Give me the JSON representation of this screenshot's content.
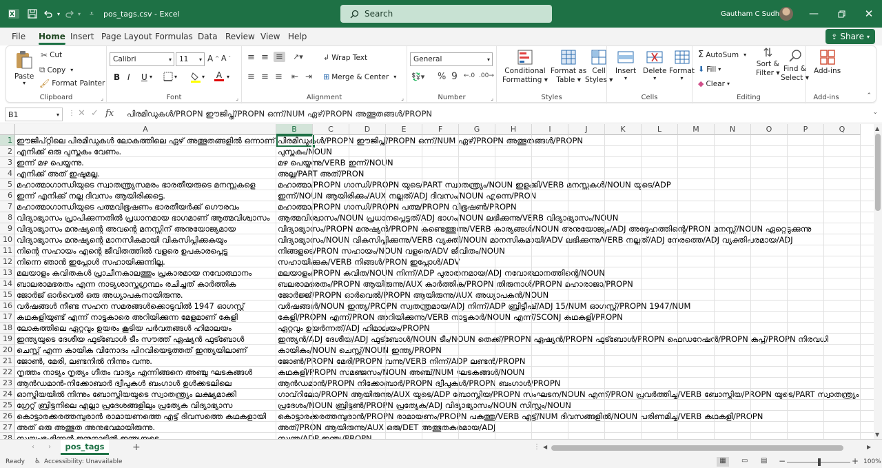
{
  "titlebar": {
    "filename": "pos_tags.csv",
    "app": "Excel",
    "search_placeholder": "Search",
    "user": "Gautham C Sudheer"
  },
  "menu": {
    "tabs": [
      "File",
      "Home",
      "Insert",
      "Page Layout",
      "Formulas",
      "Data",
      "Review",
      "View",
      "Help"
    ],
    "active": "Home",
    "share": "Share"
  },
  "ribbon": {
    "clipboard": {
      "paste": "Paste",
      "cut": "Cut",
      "copy": "Copy",
      "format_painter": "Format Painter",
      "label": "Clipboard"
    },
    "font": {
      "name": "Calibri",
      "size": "11",
      "bold": "B",
      "italic": "I",
      "underline": "U",
      "label": "Font"
    },
    "alignment": {
      "wrap": "Wrap Text",
      "merge": "Merge & Center",
      "label": "Alignment"
    },
    "number": {
      "format": "General",
      "label": "Number"
    },
    "styles": {
      "conditional": "Conditional",
      "conditional2": "Formatting",
      "format_table": "Format as",
      "format_table2": "Table",
      "cell_styles": "Cell",
      "cell_styles2": "Styles",
      "label": "Styles"
    },
    "cells": {
      "insert": "Insert",
      "delete": "Delete",
      "format": "Format",
      "label": "Cells"
    },
    "editing": {
      "autosum": "AutoSum",
      "fill": "Fill",
      "clear": "Clear",
      "sort": "Sort &",
      "sort2": "Filter",
      "find": "Find &",
      "find2": "Select",
      "label": "Editing"
    },
    "addins": {
      "addins": "Add-ins",
      "label": "Add-ins"
    }
  },
  "formula_bar": {
    "name_box": "B1",
    "fx": "fx",
    "content": "പിരമിഡുകൾ/PROPN ഈജിപ്ത്/PROPN ഒന്ന്/NUM ഏഴ്/PROPN അത്ഭുതങ്ങൾ/PROPN"
  },
  "grid": {
    "columns": [
      "A",
      "B",
      "C",
      "D",
      "E",
      "F",
      "G",
      "H",
      "I",
      "J",
      "K",
      "L",
      "M",
      "N",
      "O",
      "P",
      "Q"
    ],
    "selected_cell": "B1",
    "rows": [
      {
        "n": "1",
        "a": "ഈജിപ്റ്റിലെ പിരമിഡുകൾ ലോകത്തിലെ ഏഴ് അത്ഭുതങ്ങളിൽ ഒന്നാണ്",
        "b": "പിരമിഡുകൾ/PROPN ഈജിപ്ത്/PROPN ഒന്ന്/NUM ഏഴ്/PROPN അത്ഭുതങ്ങൾ/PROPN"
      },
      {
        "n": "2",
        "a": "എനിക്ക് ഒരു പുസ്തകം വേണം.",
        "b": "പുസ്തകം/NOUN"
      },
      {
        "n": "3",
        "a": "ഇന്ന് മഴ പെയ്യുന്നു.",
        "b": "മഴ പെയ്യുന്നു/VERB ഇന്ന്/NOUN"
      },
      {
        "n": "4",
        "a": "എനിക്ക് അത് ഇഷ്ടമല്ല.",
        "b": "അല്ല/PART അത്/PRON"
      },
      {
        "n": "5",
        "a": "മഹാത്മാഗാന്ധിയുടെ സ്വാതന്ത്ര്യസമരം ഭാരതീയരുടെ മനസ്സുകളെ",
        "b": "മഹാത്മാ/PROPN ഗാന്ധി/PROPN യുടെ/PART സ്വാതന്ത്ര്യം/NOUN ഇളക്കി/VERB മനസ്സുകൾ/NOUN യുടെ/ADP"
      },
      {
        "n": "6",
        "a": "ഇന്ന് എനിക്ക് നല്ല ദിവസം ആയിരിക്കട്ടെ.",
        "b": "ഇന്ന്/NOUN ആയിരിക്കും/AUX നല്ലത്/ADJ ദിവസം/NOUN എന്നെ/PRON"
      },
      {
        "n": "7",
        "a": "മഹാത്മാഗാന്ധിയുടെ പത്മവിഭൂഷണം ഭാരതീയർക്ക് ഗൌരവം",
        "b": "മഹാത്മാ/PROPN ഗാന്ധി/PROPN പത്മ/PROPN വിഭൂഷൺ/PROPN"
      },
      {
        "n": "8",
        "a": "വിദ്യാഭ്യാസം പ്രാപിക്കുന്നതിൽ പ്രധാനമായ ഭാഗമാണ് ആത്മവിശ്വാസം",
        "b": "ആത്മവിശ്വാസം/NOUN പ്രധാനപ്പെട്ടത്/ADJ ഭാഗം/NOUN ലഭിക്കുന്നു/VERB വിദ്യാഭ്യാസം/NOUN"
      },
      {
        "n": "9",
        "a": "വിദ്യാഭ്യാസം മനുഷ്യന്റെ അവന്റെ മനസ്സിന് അനുയോജ്യമായ",
        "b": "വിദ്യാഭ്യാസം/PROPN മനുഷ്യൻ/PROPN കണ്ടെത്തുന്നു/VERB കാര്യങ്ങൾ/NOUN അനുയോജ്യം/ADJ അദ്ദേഹത്തിന്റെ/PRON മനസ്സ്/NOUN ഏറ്റെടുക്കുന്നു"
      },
      {
        "n": "10",
        "a": "വിദ്യാഭ്യാസം മനുഷ്യന്റെ മാനസികമായി വികസിപ്പിക്കുകയും",
        "b": "വിദ്യാഭ്യാസം/NOUN വികസിപ്പിക്കുന്നു/VERB വ്യക്തി/NOUN മാനസികമായി/ADV ലഭിക്കുന്നു/VERB നല്ലത്/ADJ നേരത്തെ/ADJ വ്യക്തിപരമായ/ADJ"
      },
      {
        "n": "11",
        "a": "നിന്റെ സഹായം എന്റെ ജീവിതത്തിൽ വളരെ ഉപകാരപ്പെട്ടു",
        "b": "നിങ്ങളുടെ/PRON സഹായം/NOUN വളരെ/ADV ജീവിതം/NOUN"
      },
      {
        "n": "12",
        "a": "നിന്നെ ഞാൻ ഇപ്പോൾ സഹായിക്കുന്നില്ല.",
        "b": "സഹായിക്കുക/VERB നിങ്ങൾ/PRON ഇപ്പോൾ/ADV"
      },
      {
        "n": "13",
        "a": "മലയാളം കവിതകൾ പ്രാചീനകാലത്തും പ്രകാരമായ നവോത്ഥാനം",
        "b": "മലയാളം/PROPN കവിത/NOUN നിന്ന്/ADP പുരാതനമായ/ADJ നവോത്ഥാനത്തിന്റെ/NOUN"
      },
      {
        "n": "14",
        "a": "ബാലരാമഭരതം എന്ന നാട്യശാസ്ത്രഗ്രന്ഥം രചിച്ചത് കാർത്തിക",
        "b": "ബലരാമഭരതം/PROPN ആയിരുന്നു/AUX കാർത്തിക/PROPN തിരുനാൾ/PROPN മഹാരാജാ/PROPN"
      },
      {
        "n": "15",
        "a": "ജോർജ് ഓർവെൽ ഒരു അധ്യാപകനായിരുന്നു.",
        "b": "ജോർജ്ജ്/PROPN ഓർവെൽ/PROPN ആയിരുന്നു/AUX അധ്യാപകൻ/NOUN"
      },
      {
        "n": "16",
        "a": "വർഷങ്ങൾ നീണ്ട സഹന സമരങ്ങൾക്കൊടുവിൽ 1947 ഓഗസ്റ്റ്",
        "b": "വർഷങ്ങൾ/NOUN ഇന്ത്യ/PROPN സ്വതന്ത്രമായ/ADJ നിന്ന്/ADP ബ്രിട്ടീഷ്/ADJ 15/NUM ഓഗസ്റ്റ്/PROPN 1947/NUM"
      },
      {
        "n": "17",
        "a": "കഥകളിയുണ്ട് എന്ന് നാട്ടുകാരെ അറിയിക്കുന്ന മേളമാണ് കേളി",
        "b": "കേളി/PROPN എന്ന്/PRON അറിയിക്കുന്നു/VERB നാട്ടുകാർ/NOUN എന്ന്/SCONJ കഥകളി/PROPN"
      },
      {
        "n": "18",
        "a": "ലോകത്തിലെ ഏറ്റവും ഉയരം കൂടിയ പർവതങ്ങൾ ഹിമാലയം",
        "b": "ഏറ്റവും ഉയർന്നത്/ADJ ഹിമാലയം/PROPN"
      },
      {
        "n": "19",
        "a": "ഇന്ത്യയുടെ ദേശീയ ഫുട്ബോൾ ടീം സൗത്ത് ഏഷ്യൻ ഫുട്ബോൾ",
        "b": "ഇന്ത്യൻ/ADJ ദേശീയ/ADJ ഫുട്ബോൾ/NOUN ടീം/NOUN തെക്ക്/PROPN ഏഷ്യൻ/PROPN ഫുട്ബോൾ/PROPN ഫെഡറേഷൻ/PROPN കപ്പ്/PROPN നിരവധി"
      },
      {
        "n": "20",
        "a": "ചെസ്സ് എന്ന കായിക വിനോദം പിറവിയെടുത്തത് ഇന്ത്യയിലാണ്",
        "b": "കായികം/NOUN ചെസ്സ്/NOUN ഇന്ത്യ/PROPN"
      },
      {
        "n": "21",
        "a": "ജോൺ, മേരി, ലണ്ടനിൽ നിന്നും വന്നു.",
        "b": "ജോൺ/PROPN മേരി/PROPN വന്നു/VERB നിന്ന്/ADP ലണ്ടൻ/PROPN"
      },
      {
        "n": "22",
        "a": "നൃത്തം നാട്യം നൃത്യം ഗീതം വാദ്യം എന്നിങ്ങനെ അഞ്ചു ഘടകങ്ങൾ",
        "b": "കഥകളി/PROPN സമഞ്ജസം/NOUN അഞ്ച്/NUM ഘടകങ്ങൾ/NOUN"
      },
      {
        "n": "23",
        "a": "ആൻഡമാൻ-നിക്കോബാർ ദ്വീപുകൾ ബംഗാൾ ഉൾക്കടലിലെ",
        "b": "ആൻഡമാൻ/PROPN നിക്കോബാർ/PROPN ദ്വീപുകൾ/PROPN ബംഗാൾ/PROPN"
      },
      {
        "n": "24",
        "a": "ഓസ്ട്രിയയിൽ നിന്നും ബോസ്നിയയുടെ സ്വാതന്ത്ര്യം ലക്ഷ്യമാക്കി",
        "b": "ഗാവ്‌റിലോ/PROPN ആയിരുന്നു/AUX യുടെ/ADP ബോസ്നിയ/PROPN സംഘടന/NOUN എന്ന്/PRON പ്രവർത്തിച്ചു/VERB ബോസ്നിയ/PROPN യുടെ/PART സ്വാതന്ത്ര്യം"
      },
      {
        "n": "25",
        "a": "ഗ്രേറ്റ് ബ്രിട്ടനിലെ എല്ലാ പ്രദേശങ്ങളിലും പ്രത്യേക വിദ്യാഭ്യാസ",
        "b": "പ്രദേശം/NOUN ബ്രിട്ടൺ/PROPN പ്രത്യേക/ADJ വിദ്യാഭ്യാസം/NOUN സിസ്റ്റം/NOUN"
      },
      {
        "n": "26",
        "a": "കൊട്ടാരക്കരത്തമ്പുരാൻ രാമായണത്തെ എട്ട് ദിവസത്തെ കഥകളായി",
        "b": "കൊട്ടാരക്കരത്തമ്പുരാൻ/PROPN രാമായണം/PROPN പകുത്തു/VERB എട്ട്/NUM ദിവസങ്ങളിൽ/NOUN പരിണമിച്ചു/VERB കഥകളി/PROPN"
      },
      {
        "n": "27",
        "a": "അത് ഒരു അത്ഭുത അനുഭവമായിരുന്നു.",
        "b": "അത്/PRON ആയിരുന്നു/AUX ഒരു/DET അത്ഭുതകരമായ/ADJ"
      },
      {
        "n": "28",
        "a": "സ്വയംഭൂ-ഭിന്നൻ ജന്മനാട്ടിൽ ഇന്ത്യയുടെ",
        "b": "സ്വന്ത/ADP ഇന്ത്യ/PROPN"
      }
    ]
  },
  "sheets": {
    "active": "pos_tags",
    "add": "+"
  },
  "status": {
    "ready": "Ready",
    "accessibility": "Accessibility: Unavailable",
    "zoom": "100%"
  }
}
